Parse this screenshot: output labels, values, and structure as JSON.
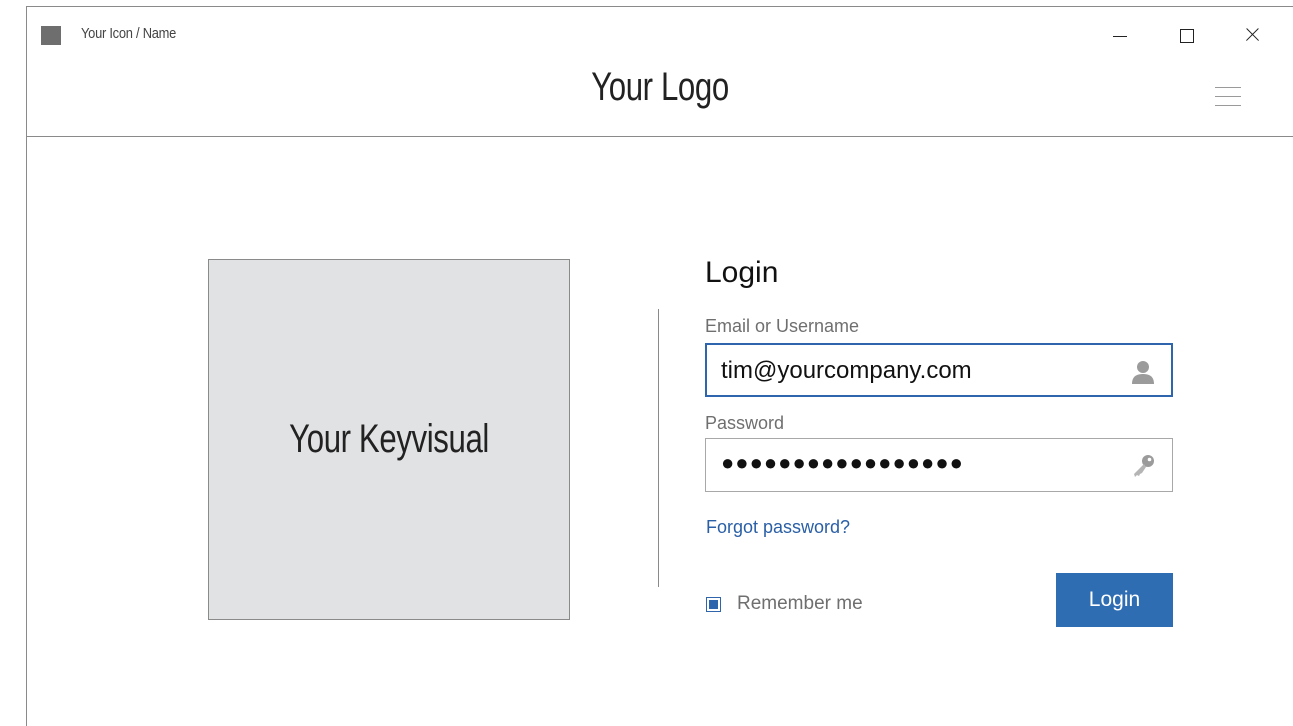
{
  "window": {
    "app_name": "Your Icon / Name",
    "logo": "Your Logo"
  },
  "keyvisual": {
    "label": "Your Keyvisual"
  },
  "login": {
    "title": "Login",
    "email_label": "Email or Username",
    "email_value": "tim@yourcompany.com",
    "password_label": "Password",
    "password_value": "●●●●●●●●●●●●●●●●●",
    "forgot_label": "Forgot password?",
    "remember_label": "Remember me",
    "remember_checked": true,
    "button_label": "Login"
  },
  "icons": {
    "app": "app-icon",
    "minimize": "minimize-icon",
    "maximize": "maximize-icon",
    "close": "close-icon",
    "menu": "hamburger-menu-icon",
    "user": "user-icon",
    "key": "key-icon"
  },
  "colors": {
    "accent": "#2f6db3",
    "link": "#2a5fa6",
    "keyvisual_bg": "#e1e2e4",
    "border": "#8a8a8a"
  }
}
